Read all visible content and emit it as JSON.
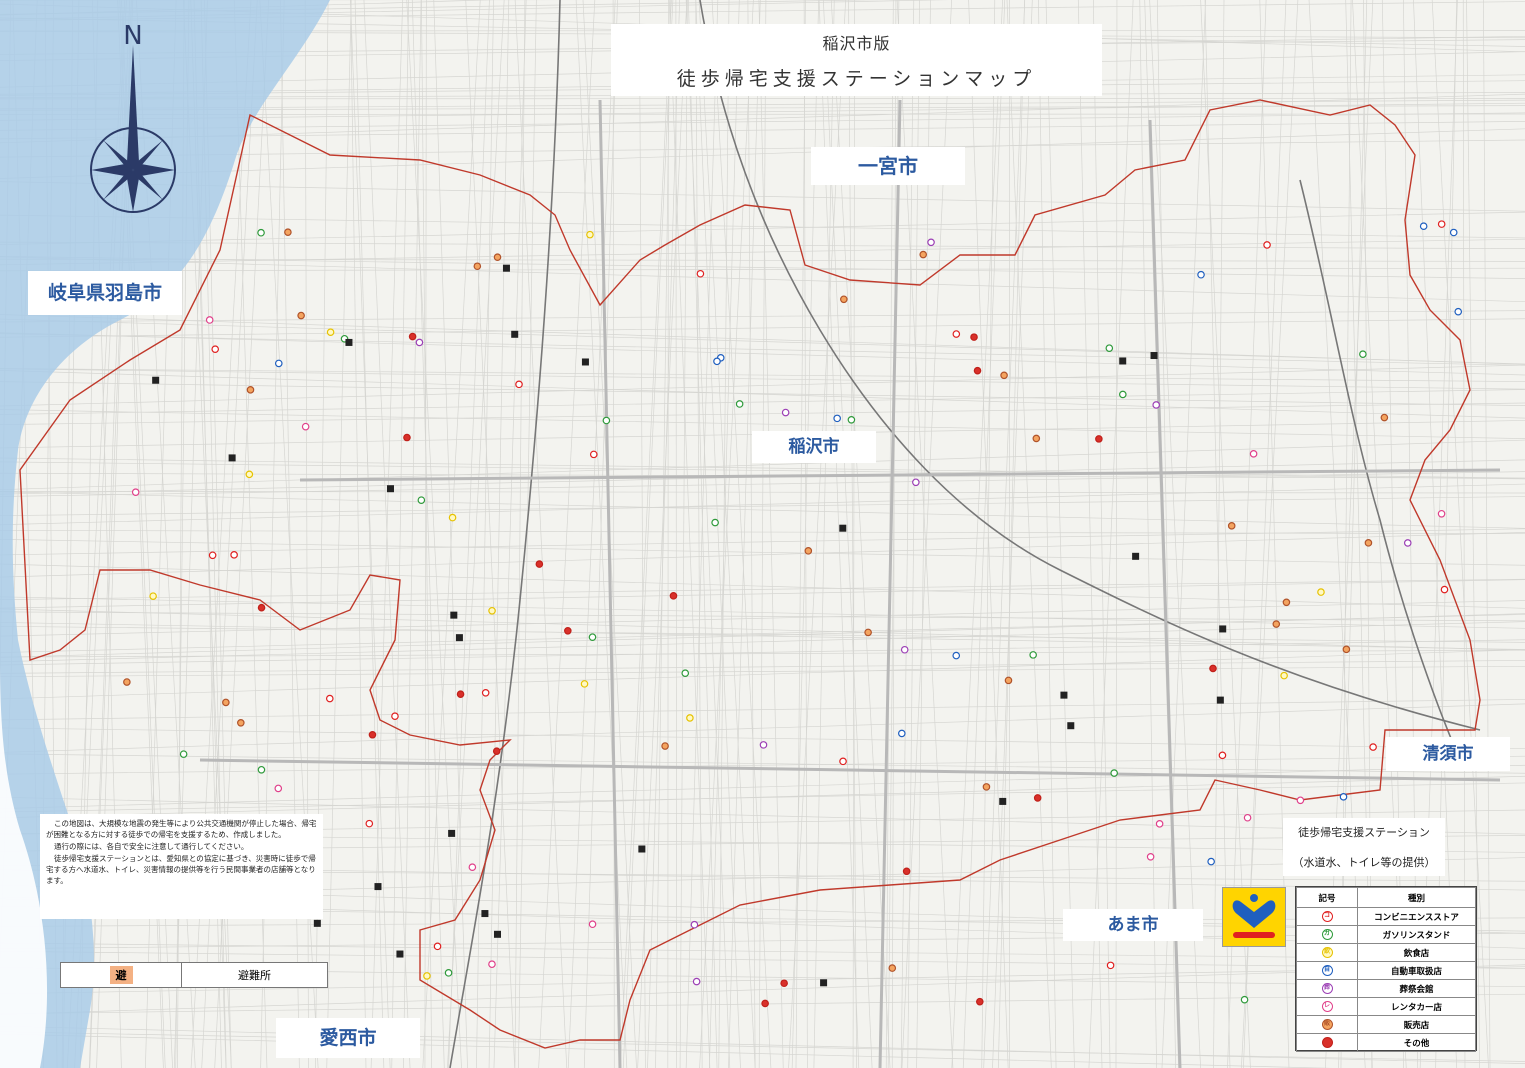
{
  "title": {
    "subtitle": "稲沢市版",
    "main": "徒歩帰宅支援ステーションマップ"
  },
  "compass": {
    "label": "N"
  },
  "cities": {
    "ichinomiya": "一宮市",
    "hashima": "岐阜県羽島市",
    "inazawa": "稲沢市",
    "kiyosu": "清須市",
    "ama": "あま市",
    "aisai": "愛西市"
  },
  "notice": {
    "lines": [
      "この地図は、大規模な地震の発生等により公共交通機関が停止した場合、帰宅が困難となる方に対する徒歩での帰宅を支援するため、作成しました。",
      "通行の際には、各自で安全に注意して通行してください。",
      "徒歩帰宅支援ステーションとは、愛知県との協定に基づき、災害時に徒歩で帰宅する方へ水道水、トイレ、災害情報の提供等を行う民間事業者の店舗等となります。"
    ]
  },
  "shelter": {
    "symbol": "避",
    "label": "避難所"
  },
  "station_info": {
    "title": "徒歩帰宅支援ステーション",
    "subtitle": "（水道水、トイレ等の提供）"
  },
  "legend": {
    "header_symbol": "記号",
    "header_type": "種別",
    "items": [
      {
        "glyph": "コ",
        "label": "コンビニエンスストア",
        "color": "#e02020",
        "fill": "#ffffff"
      },
      {
        "glyph": "ガ",
        "label": "ガソリンスタンド",
        "color": "#2e9a3a",
        "fill": "#ffffff"
      },
      {
        "glyph": "飲",
        "label": "飲食店",
        "color": "#e6c200",
        "fill": "#fff9c4"
      },
      {
        "glyph": "自",
        "label": "自動車取扱店",
        "color": "#1f5fbf",
        "fill": "#ffffff"
      },
      {
        "glyph": "葬",
        "label": "葬祭会館",
        "color": "#9c3fb5",
        "fill": "#ffffff"
      },
      {
        "glyph": "レ",
        "label": "レンタカー店",
        "color": "#e0408a",
        "fill": "#ffffff"
      },
      {
        "glyph": "販",
        "label": "販売店",
        "color": "#b0532a",
        "fill": "#f4a460"
      },
      {
        "glyph": "",
        "label": "その他",
        "color": "#c0201a",
        "fill": "#d9302a"
      }
    ]
  },
  "colors": {
    "boundary": "#c0392b",
    "river": "#9fc5e8",
    "road": "#cfcfcf",
    "city_label": "#2c5aa0",
    "compass": "#2b3a67"
  }
}
